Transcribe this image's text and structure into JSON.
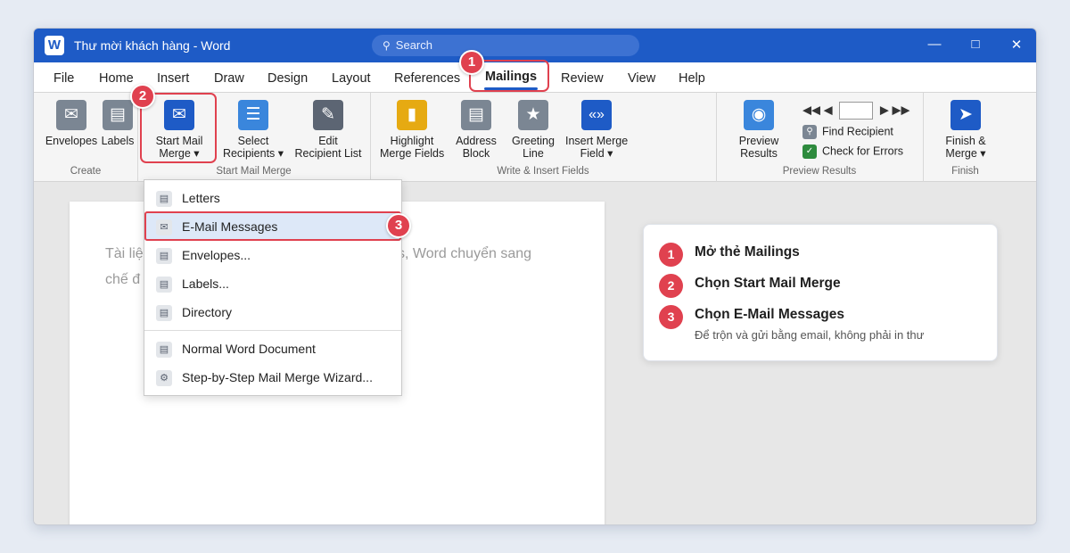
{
  "window": {
    "title": "Thư mời khách hàng - Word",
    "app_logo": "W",
    "search_placeholder": "Search",
    "controls": {
      "minimize": "—",
      "maximize": "□",
      "close": "✕"
    }
  },
  "tabs": [
    {
      "label": "File"
    },
    {
      "label": "Home"
    },
    {
      "label": "Insert"
    },
    {
      "label": "Draw"
    },
    {
      "label": "Design"
    },
    {
      "label": "Layout"
    },
    {
      "label": "References"
    },
    {
      "label": "Mailings",
      "active": true
    },
    {
      "label": "Review"
    },
    {
      "label": "View"
    },
    {
      "label": "Help"
    }
  ],
  "ribbon": {
    "create": {
      "label": "Create",
      "envelopes": {
        "line1": "Envelopes",
        "icon": "envelope-icon"
      },
      "labels": {
        "line1": "Labels",
        "icon": "labels-icon"
      }
    },
    "start_mail_merge": {
      "label": "Start Mail Merge",
      "start": {
        "line1": "Start Mail",
        "line2": "Merge ▾",
        "icon": "mail-merge-icon"
      },
      "select": {
        "line1": "Select",
        "line2": "Recipients ▾",
        "icon": "recipients-icon"
      },
      "edit": {
        "line1": "Edit",
        "line2": "Recipient List",
        "icon": "edit-icon"
      }
    },
    "write_insert": {
      "label": "Write & Insert Fields",
      "highlight": {
        "line1": "Highlight",
        "line2": "Merge Fields",
        "icon": "highlight-icon"
      },
      "address": {
        "line1": "Address",
        "line2": "Block",
        "icon": "address-block-icon"
      },
      "greeting": {
        "line1": "Greeting",
        "line2": "Line",
        "icon": "greeting-icon"
      },
      "insert_field": {
        "line1": "Insert Merge",
        "line2": "Field ▾",
        "icon": "merge-field-icon"
      }
    },
    "preview": {
      "label": "Preview Results",
      "preview_results": {
        "line1": "Preview",
        "line2": "Results",
        "icon": "preview-icon"
      },
      "nav": {
        "first": "◀◀",
        "prev": "◀",
        "next": "▶",
        "last": "▶▶"
      },
      "find_recipient": "Find Recipient",
      "check_errors": "Check for Errors"
    },
    "finish": {
      "label": "Finish",
      "finish_merge": {
        "line1": "Finish &",
        "line2": "Merge ▾",
        "icon": "send-icon"
      }
    }
  },
  "document": {
    "text_line1_left": "Tài liệ",
    "text_line1_right": "s, Word chuyển sang",
    "text_line2_left": "chế đ"
  },
  "dropdown": {
    "items": [
      {
        "label": "Letters",
        "icon": "letter-icon"
      },
      {
        "label": "E-Mail Messages",
        "icon": "email-icon",
        "selected": true
      },
      {
        "label": "Envelopes...",
        "icon": "envelope-doc-icon"
      },
      {
        "label": "Labels...",
        "icon": "labels-doc-icon"
      },
      {
        "label": "Directory",
        "icon": "directory-icon"
      },
      {
        "label": "Normal Word Document",
        "icon": "word-doc-icon"
      },
      {
        "label": "Step-by-Step Mail Merge Wizard...",
        "icon": "wizard-gear-icon"
      }
    ]
  },
  "badges": [
    "1",
    "2",
    "3"
  ],
  "steps": [
    {
      "num": "1",
      "title": "Mở thẻ Mailings"
    },
    {
      "num": "2",
      "title": "Chọn Start Mail Merge"
    },
    {
      "num": "3",
      "title": "Chọn E-Mail Messages",
      "note": "Để trộn và gửi bằng email, không phải in thư"
    }
  ],
  "colors": {
    "title_bar": "#1e5bc6",
    "highlight": "#e0414f",
    "selected_item": "#dde8f8"
  }
}
